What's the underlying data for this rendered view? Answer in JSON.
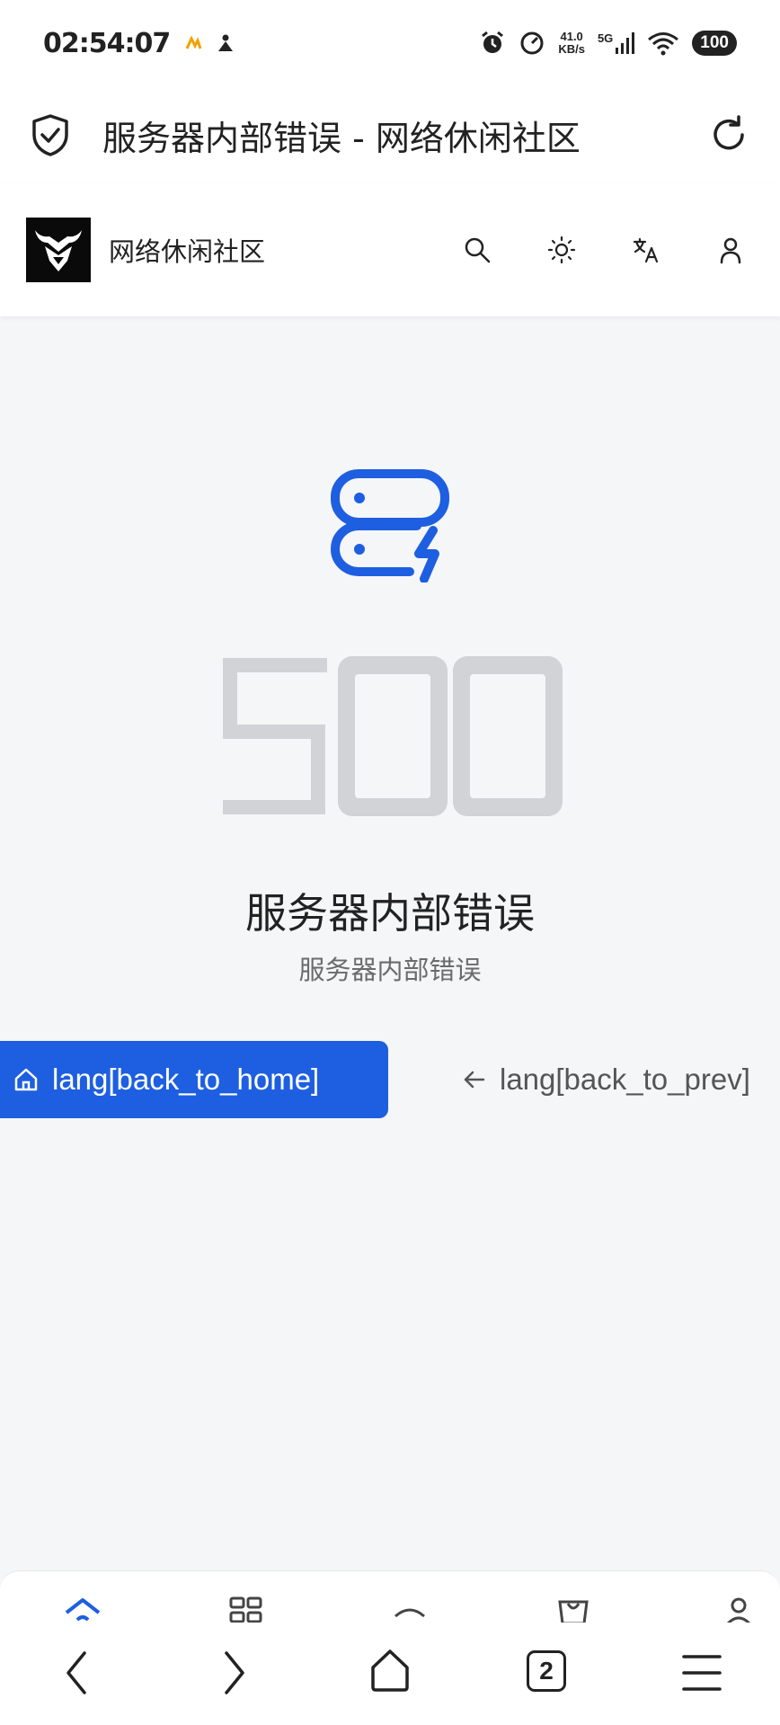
{
  "status_bar": {
    "time": "02:54:07",
    "net_speed_value": "41.0",
    "net_speed_unit": "KB/s",
    "signal_label": "5G",
    "battery": "100"
  },
  "browser": {
    "page_title": "服务器内部错误 - 网络休闲社区"
  },
  "site": {
    "name": "网络休闲社区"
  },
  "error": {
    "code": "500",
    "title": "服务器内部错误",
    "message": "服务器内部错误",
    "accent": "#1d5fe0"
  },
  "actions": {
    "home_label": "lang[back_to_home]",
    "prev_label": "lang[back_to_prev]"
  },
  "browser_nav": {
    "tab_count": "2"
  }
}
